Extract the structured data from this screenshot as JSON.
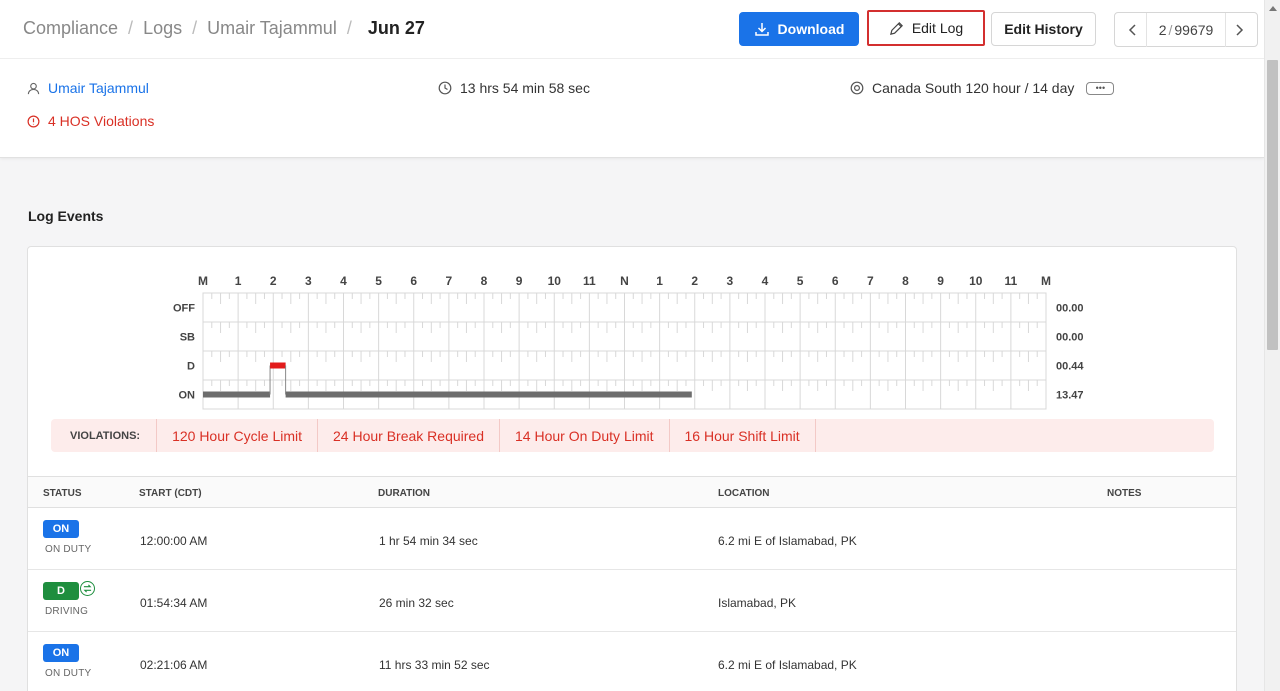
{
  "breadcrumb": {
    "items": [
      "Compliance",
      "Logs",
      "Umair Tajammul"
    ],
    "current": "Jun 27"
  },
  "toolbar": {
    "download_label": "Download",
    "edit_log_label": "Edit Log",
    "edit_history_label": "Edit History",
    "pager": {
      "current": "2",
      "total": "99679"
    }
  },
  "summary": {
    "driver": "Umair Tajammul",
    "violations": "4 HOS Violations",
    "duration": "13 hrs 54 min 58 sec",
    "ruleset": "Canada South 120 hour / 14 day",
    "more": "•••"
  },
  "section_title": "Log Events",
  "chart_data": {
    "type": "hos-log-grid",
    "hour_labels": [
      "M",
      "1",
      "2",
      "3",
      "4",
      "5",
      "6",
      "7",
      "8",
      "9",
      "10",
      "11",
      "N",
      "1",
      "2",
      "3",
      "4",
      "5",
      "6",
      "7",
      "8",
      "9",
      "10",
      "11",
      "M"
    ],
    "rows": [
      {
        "label": "OFF",
        "total": "00.00"
      },
      {
        "label": "SB",
        "total": "00.00"
      },
      {
        "label": "D",
        "total": "00.44"
      },
      {
        "label": "ON",
        "total": "13.47"
      }
    ],
    "segments": [
      {
        "status": "ON",
        "start_hour": 0.0,
        "end_hour": 1.909
      },
      {
        "status": "D",
        "start_hour": 1.909,
        "end_hour": 2.352
      },
      {
        "status": "ON",
        "start_hour": 2.352,
        "end_hour": 13.916
      }
    ],
    "colors": {
      "ON": "#6d6d6d",
      "D": "#e21b1b",
      "grid": "#d8d8d8"
    }
  },
  "violations_bar": {
    "label": "VIOLATIONS:",
    "items": [
      "120 Hour Cycle Limit",
      "24 Hour Break Required",
      "14 Hour On Duty Limit",
      "16 Hour Shift Limit"
    ]
  },
  "table": {
    "columns": [
      "STATUS",
      "START (CDT)",
      "DURATION",
      "LOCATION",
      "NOTES"
    ],
    "rows": [
      {
        "badge": "ON",
        "status": "ON DUTY",
        "start": "12:00:00 AM",
        "duration": "1 hr 54 min 34 sec",
        "location": "6.2 mi E of Islamabad, PK",
        "notes": ""
      },
      {
        "badge": "D",
        "status": "DRIVING",
        "start": "01:54:34 AM",
        "duration": "26 min 32 sec",
        "location": "Islamabad, PK",
        "notes": ""
      },
      {
        "badge": "ON",
        "status": "ON DUTY",
        "start": "02:21:06 AM",
        "duration": "11 hrs 33 min 52 sec",
        "location": "6.2 mi E of Islamabad, PK",
        "notes": ""
      }
    ]
  },
  "colors": {
    "accent": "#1a73e8",
    "danger": "#d93025",
    "driving": "#1e8e3e"
  }
}
